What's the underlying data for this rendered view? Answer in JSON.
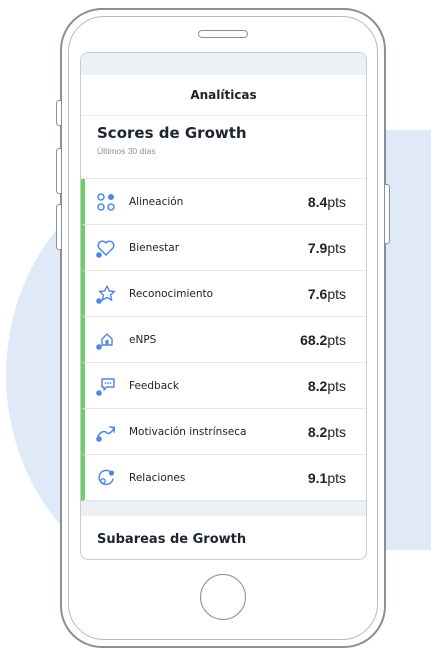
{
  "colors": {
    "accent": "#4f86e6",
    "indicator": "#6fd06a",
    "background_blob": "#dfe9f8"
  },
  "header": {
    "title": "Analíticas"
  },
  "section": {
    "title": "Scores de Growth",
    "subtitle": "Últimos 30 días"
  },
  "scores": [
    {
      "label": "Alineación",
      "value": "8.4",
      "unit": "pts",
      "icon": "alignment-dots-icon"
    },
    {
      "label": "Bienestar",
      "value": "7.9",
      "unit": "pts",
      "icon": "heart-icon"
    },
    {
      "label": "Reconocimiento",
      "value": "7.6",
      "unit": "pts",
      "icon": "star-icon"
    },
    {
      "label": "eNPS",
      "value": "68.2",
      "unit": "pts",
      "icon": "home-icon"
    },
    {
      "label": "Feedback",
      "value": "8.2",
      "unit": "pts",
      "icon": "chat-bubble-icon"
    },
    {
      "label": "Motivación instrínseca",
      "value": "8.2",
      "unit": "pts",
      "icon": "trend-arrow-icon"
    },
    {
      "label": "Relaciones",
      "value": "9.1",
      "unit": "pts",
      "icon": "relations-icon"
    }
  ],
  "subareas": {
    "title": "Subareas de Growth"
  }
}
